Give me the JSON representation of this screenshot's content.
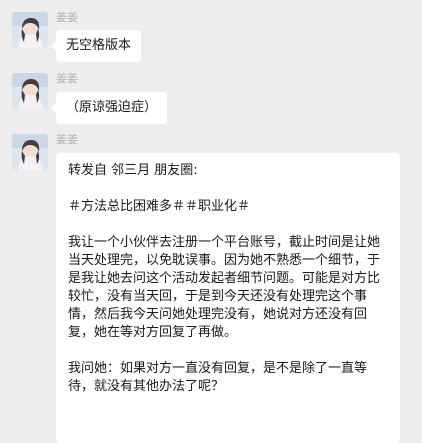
{
  "messages": [
    {
      "sender": "姜姜",
      "avatar_icon": "profile-photo-icon",
      "text": "无空格版本"
    },
    {
      "sender": "姜姜",
      "avatar_icon": "profile-photo-icon",
      "text": "（原谅强迫症）"
    },
    {
      "sender": "姜姜",
      "avatar_icon": "profile-photo-icon",
      "paragraphs": [
        "转发自 邻三月 朋友圈:",
        "＃方法总比困难多＃＃职业化＃",
        "我让一个小伙伴去注册一个平台账号，截止时间是让她当天处理完，以免耽误事。因为她不熟悉一个细节，于是我让她去问这个活动发起者细节问题。可能是对方比较忙，没有当天回，于是到今天还没有处理完这个事情，然后我今天问她处理完没有，她说对方还没有回复，她在等对方回复了再做。",
        "我问她：如果对方一直没有回复，是不是除了一直等待，就没有其他办法了呢？"
      ]
    }
  ],
  "colors": {
    "background": "#ededed",
    "bubble": "#ffffff",
    "sender_name": "#b2b2b2",
    "text": "#191919"
  }
}
